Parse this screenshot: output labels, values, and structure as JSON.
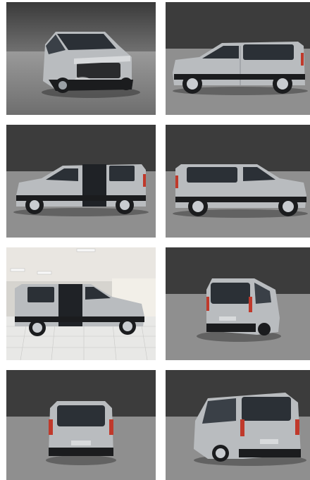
{
  "gallery": {
    "photos": [
      {
        "view": "front-three-quarter",
        "scene": "studio"
      },
      {
        "view": "side-right",
        "scene": "studio"
      },
      {
        "view": "side-left-doors-open",
        "scene": "studio"
      },
      {
        "view": "side-left",
        "scene": "studio"
      },
      {
        "view": "side-right-door-open",
        "scene": "showroom"
      },
      {
        "view": "rear-three-quarter",
        "scene": "studio"
      },
      {
        "view": "rear",
        "scene": "studio"
      },
      {
        "view": "rear-three-quarter-left",
        "scene": "studio"
      }
    ],
    "colors": {
      "wall_top": "#2f2f2f",
      "wall_bottom": "#6a6a6a",
      "floor": "#8a8a8a",
      "body": "#b9bcbf",
      "body_dark": "#8e9297",
      "glass": "#2b3036",
      "trim": "#1b1c1e",
      "tail_light": "#c0392b"
    }
  }
}
